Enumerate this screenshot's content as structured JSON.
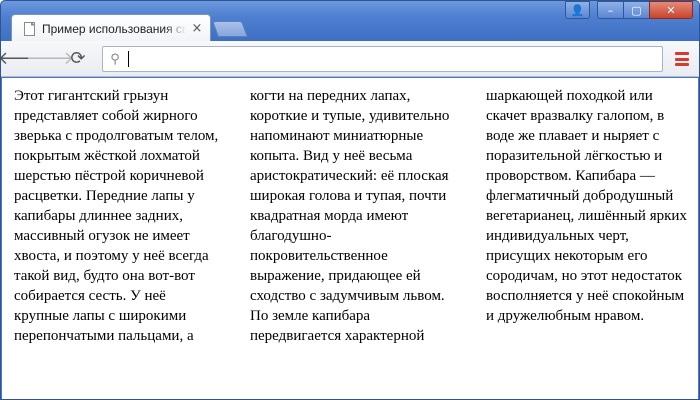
{
  "browser": {
    "tab_title": "Пример использования сво",
    "tab_close": "×",
    "address_value": "",
    "icons": {
      "page": "document-icon",
      "back": "arrow-left-icon",
      "forward": "arrow-right-icon",
      "reload": "reload-icon",
      "search": "magnifier-icon",
      "menu": "hamburger-menu-icon",
      "user": "user-icon",
      "minimize": "minimize-icon",
      "maximize": "maximize-icon",
      "close": "close-icon"
    },
    "glyphs": {
      "back": "🡐",
      "forward": "🡒",
      "reload": "⟳",
      "search": "⚲",
      "user": "👤",
      "minimize": "–",
      "maximize": "▢",
      "close": "✕"
    }
  },
  "article": {
    "text": "Этот гигантский грызун представляет собой жирного зверька с продолговатым телом, покрытым жёсткой лохматой шерстью пёстрой коричневой расцветки. Передние лапы у капибары длиннее задних, массивный огузок не имеет хвоста, и поэтому у неё всегда такой вид, будто она вот-вот собирается сесть. У неё крупные лапы с широкими перепончатыми пальцами, а когти на передних лапах, короткие и тупые, удивительно напоминают миниатюрные копыта. Вид у неё весьма аристократический: её плоская широкая голова и тупая, почти квадратная морда имеют благодушно-покровительственное выражение, придающее ей сходство с задумчивым львом. По земле капибара передвигается характерной шаркающей походкой или скачет вразвалку галопом, в воде же плавает и ныряет с поразительной лёгкостью и проворством. Капибара — флегматичный добродушный вегетарианец, лишённый ярких индивидуальных черт, присущих некоторым его сородичам, но этот недостаток восполняется у неё спокойным и дружелюбным нравом."
  }
}
